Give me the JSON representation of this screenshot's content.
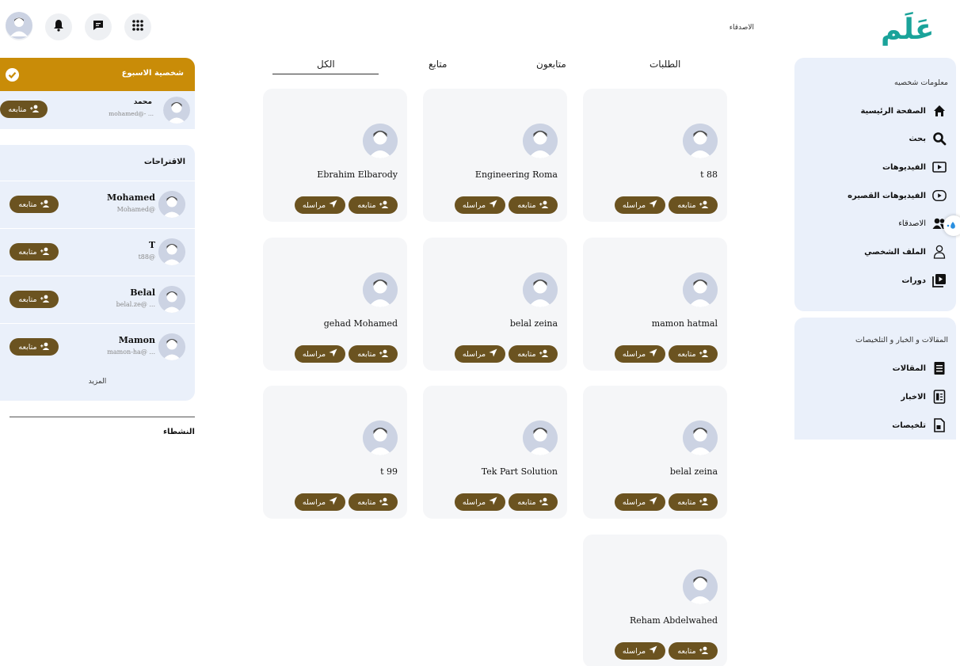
{
  "header": {
    "logo_text": "عَلَم",
    "page_label": "الاصدقاء",
    "icons": [
      "profile-avatar-icon",
      "bell-icon",
      "chat-icon",
      "apps-grid-icon"
    ]
  },
  "nav": {
    "section1_title": "معلومات شخصيه",
    "items": [
      {
        "label": "الصفحة الرئيسية",
        "icon": "home-icon"
      },
      {
        "label": "بحث",
        "icon": "search-icon"
      },
      {
        "label": "الفيديوهات",
        "icon": "video-icon"
      },
      {
        "label": "الفيديوهات القصيره",
        "icon": "play-circle-icon"
      },
      {
        "label": "الاصدقاء",
        "icon": "friends-icon"
      },
      {
        "label": "الملف الشخصي",
        "icon": "person-icon"
      },
      {
        "label": "دورات",
        "icon": "courses-icon"
      }
    ],
    "section2_title": "المقالات و الخبار و التلخيصات",
    "items2": [
      {
        "label": "المقالات",
        "icon": "article-icon"
      },
      {
        "label": "الاخبار",
        "icon": "news-icon"
      },
      {
        "label": "تلخيصات",
        "icon": "summary-icon"
      }
    ]
  },
  "tabs": [
    "الطلبات",
    "متابعون",
    "متابع",
    "الكل"
  ],
  "active_tab": "الكل",
  "buttons": {
    "follow": "متابعه",
    "message": "مراسله"
  },
  "friends": [
    {
      "name": "t 88"
    },
    {
      "name": "Engineering Roma"
    },
    {
      "name": "Ebrahim Elbarody"
    },
    {
      "name": "mamon hatmal"
    },
    {
      "name": "belal zeina"
    },
    {
      "name": "gehad Mohamed"
    },
    {
      "name": "belal zeina"
    },
    {
      "name": "Tek Part Solution"
    },
    {
      "name": "t 99"
    },
    {
      "name": "Reham Abdelwahed"
    }
  ],
  "person_of_week": {
    "title": "شخصية الاسبوع",
    "name": "محمد",
    "handle": "mohamed@- ...",
    "follow": "متابعه"
  },
  "suggestions": {
    "title": "الاقتراحات",
    "items": [
      {
        "name": "Mohamed",
        "handle": "Mohamed@"
      },
      {
        "name": "T",
        "handle": "t88@"
      },
      {
        "name": "Belal",
        "handle": "belal.ze@ ..."
      },
      {
        "name": "Mamon",
        "handle": "mamon-ha@ ..."
      }
    ],
    "more": "المزيد"
  },
  "activity_title": "النشطاء",
  "colors": {
    "accent_gold": "#c98c08",
    "button_brown": "#6b5320",
    "logo_teal": "#1aa39a",
    "card_bg": "#eaf0fa"
  }
}
